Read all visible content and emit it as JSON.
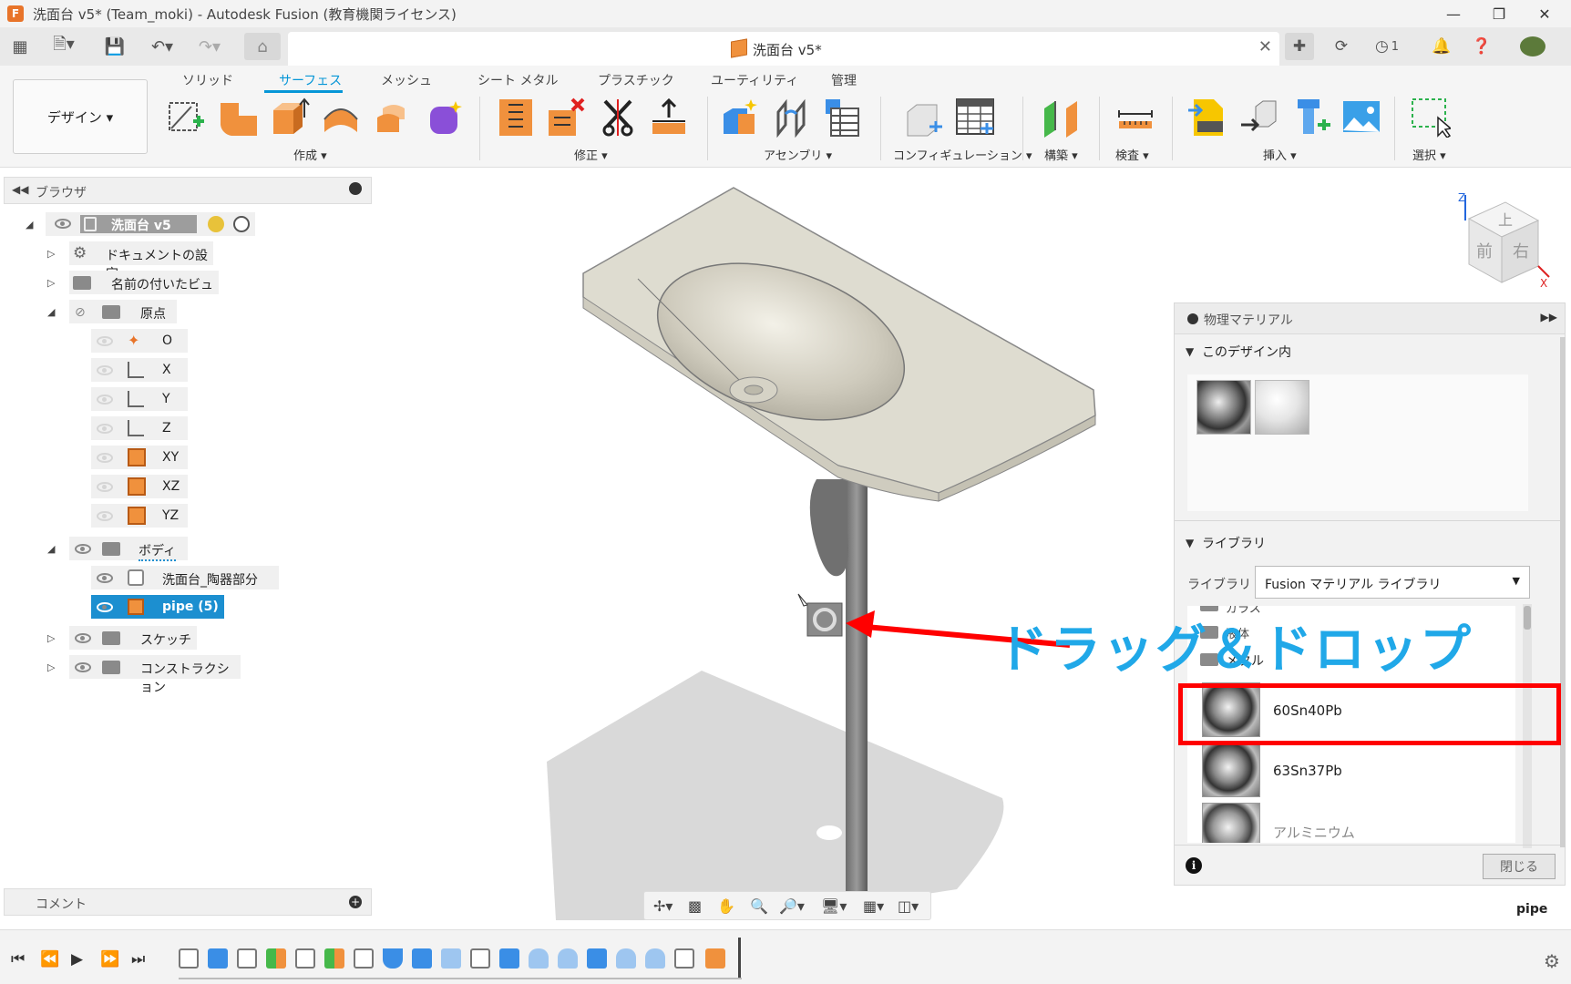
{
  "window": {
    "title": "洗面台 v5* (Team_moki) - Autodesk Fusion (教育機関ライセンス)",
    "app_icon_letter": "F"
  },
  "document_tab": {
    "label": "洗面台 v5*"
  },
  "quick_access": {
    "jobs_count": "1"
  },
  "ribbon": {
    "workspace_label": "デザイン ▾",
    "tabs": [
      "ソリッド",
      "サーフェス",
      "メッシュ",
      "シート メタル",
      "プラスチック",
      "ユーティリティ",
      "管理"
    ],
    "groups": {
      "create": "作成 ▾",
      "modify": "修正 ▾",
      "assemble": "アセンブリ ▾",
      "configure": "コンフィギュレーション ▾",
      "construct": "構築 ▾",
      "inspect": "検査 ▾",
      "insert": "挿入 ▾",
      "select": "選択 ▾"
    }
  },
  "browser": {
    "title": "ブラウザ",
    "root": "洗面台 v5",
    "items": {
      "doc_settings": "ドキュメントの設定",
      "named_views": "名前の付いたビュー",
      "origin": "原点",
      "origin_o": "O",
      "origin_x": "X",
      "origin_y": "Y",
      "origin_z": "Z",
      "origin_xy": "XY",
      "origin_xz": "XZ",
      "origin_yz": "YZ",
      "bodies": "ボディ",
      "body_ceramic": "洗面台_陶器部分",
      "body_pipe": "pipe (5)",
      "sketches": "スケッチ",
      "construction": "コンストラクション"
    }
  },
  "comment": {
    "label": "コメント"
  },
  "viewcube": {
    "top": "上",
    "front": "前",
    "right": "右",
    "axis_z": "Z",
    "axis_x": "X"
  },
  "material_panel": {
    "title": "物理マテリアル",
    "in_design_section": "このデザイン内",
    "library_section": "ライブラリ",
    "library_label": "ライブラリ",
    "library_value": "Fusion マテリアル ライブラリ",
    "folders": {
      "glass": "ガラス",
      "liquid": "液体",
      "metal": "メタル"
    },
    "items": [
      "60Sn40Pb",
      "63Sn37Pb",
      "アルミニウム"
    ],
    "close_label": "閉じる"
  },
  "annotation": {
    "text": "ドラッグ＆ドロップ"
  },
  "status": {
    "selection": "pipe"
  },
  "colors": {
    "accent": "#0696d7",
    "annotation_red": "#ff0000",
    "annotation_blue": "#20a8e8",
    "selection_blue": "#1c8fd0"
  }
}
